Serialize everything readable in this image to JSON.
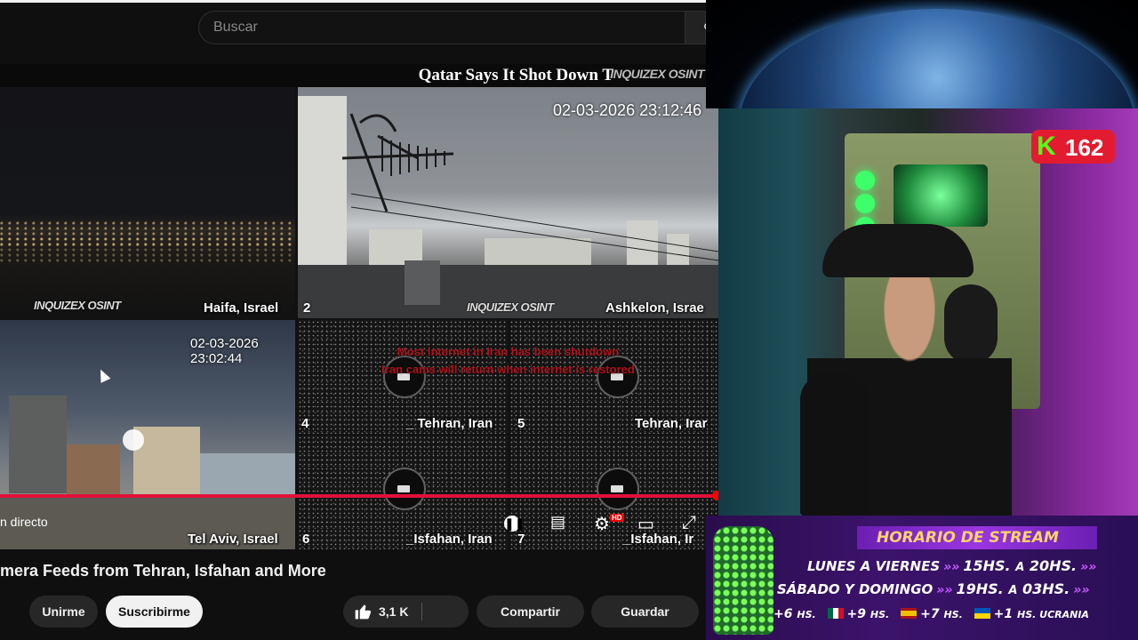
{
  "search": {
    "placeholder": "Buscar"
  },
  "ticker": {
    "text": "Qatar Says It Shot Down T",
    "logo": "INQUIZEX OSINT"
  },
  "cameras": [
    {
      "number": "",
      "label": "Haifa, Israel",
      "watermark": "INQUIZEX OSINT"
    },
    {
      "number": "2",
      "label": "Ashkelon, Israe",
      "timestamp": "02-03-2026 23:12:46",
      "watermark": "INQUIZEX OSINT"
    },
    {
      "number": "",
      "label": "Tel Aviv, Israel",
      "timestamp": "02-03-2026 23:02:44"
    },
    {
      "number": "4",
      "label": "_ Tehran, Iran"
    },
    {
      "number": "5",
      "label": "Tehran, Irar"
    },
    {
      "number": "6",
      "label": "_Isfahan, Iran"
    },
    {
      "number": "7",
      "label": "_Isfahan, Ir"
    }
  ],
  "notice": [
    "Most internet in Iran has been shutdown",
    "Iran cams will return when internet is restored"
  ],
  "player": {
    "live_label": "n directo",
    "hd_badge": "HD"
  },
  "video": {
    "title": "mera Feeds from Tehran, Isfahan and More"
  },
  "actions": {
    "join": "Unirme",
    "subscribe": "Suscribirme",
    "likes": "3,1 K",
    "share": "Compartir",
    "save": "Guardar"
  },
  "stream": {
    "kick_count": "162",
    "schedule_title": "HORARIO DE STREAM",
    "rows": [
      {
        "days": "LUNES A VIERNES",
        "from": "15HS.",
        "to_word": "A",
        "to": "20HS."
      },
      {
        "days": "SÁBADO Y DOMINGO",
        "from": "19HS.",
        "to_word": "A",
        "to": "03HS."
      }
    ],
    "timezones": [
      {
        "offset": "+6",
        "unit": "HS."
      },
      {
        "offset": "+9",
        "unit": "HS."
      },
      {
        "offset": "+7",
        "unit": "HS."
      },
      {
        "offset": "+1",
        "unit": "HS. UCRANIA"
      }
    ]
  },
  "colors": {
    "progress": "#e0113a",
    "kick_green": "#53fc18",
    "schedule_title": "#ffd36b"
  }
}
